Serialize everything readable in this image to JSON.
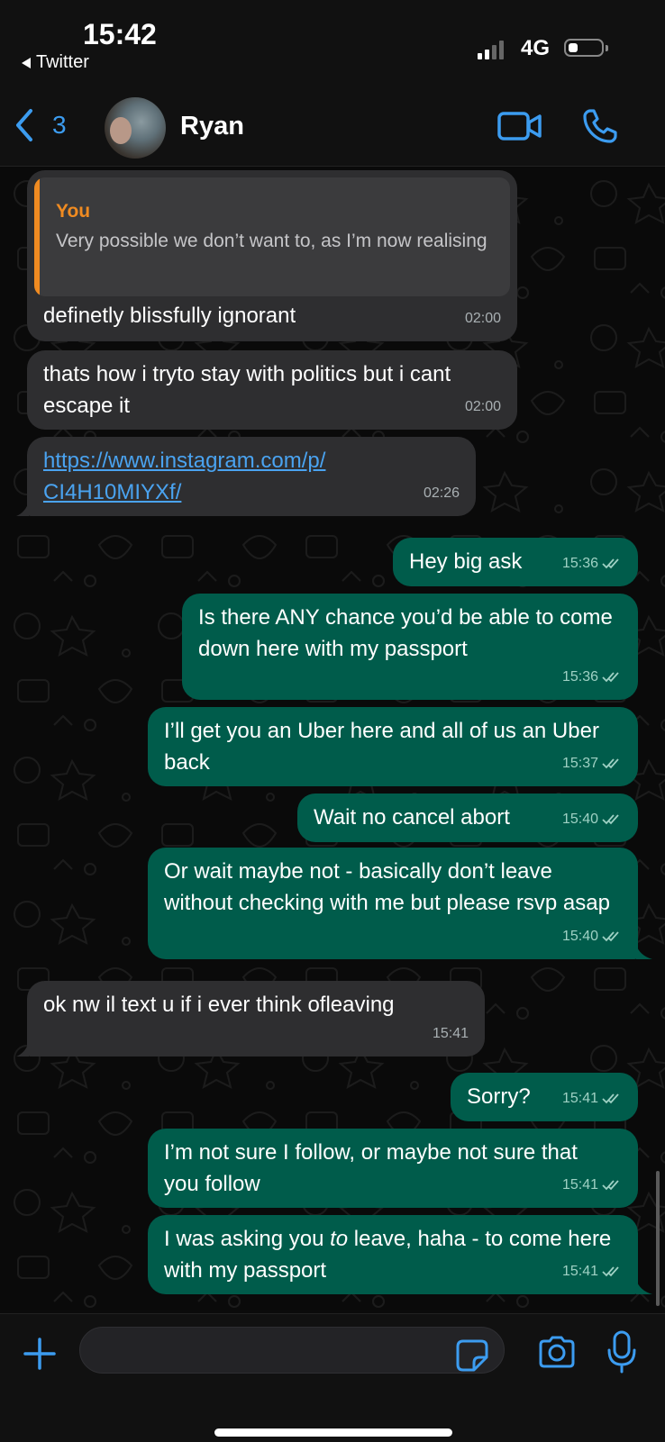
{
  "status_bar": {
    "time": "15:42",
    "back_app": "Twitter",
    "network": "4G"
  },
  "header": {
    "back_count": "3",
    "contact_name": "Ryan"
  },
  "messages": [
    {
      "dir": "in",
      "quoted_author": "You",
      "quoted_text": "Very possible we don’t want to, as I’m now realising",
      "text": "definetly blissfully ignorant",
      "time": "02:00"
    },
    {
      "dir": "in",
      "text": "thats how i tryto stay with politics but i cant escape it",
      "time": "02:00"
    },
    {
      "dir": "in",
      "text": "https://www.instagram.com/p/CI4H10MIYXf/",
      "text_line1": "https://www.instagram.com/p/",
      "text_line2": "CI4H10MIYXf/",
      "time": "02:26"
    },
    {
      "dir": "out",
      "text": "Hey big ask",
      "time": "15:36"
    },
    {
      "dir": "out",
      "text": "Is there ANY chance you’d be able to come down here with my passport",
      "time": "15:36"
    },
    {
      "dir": "out",
      "text": "I’ll get you an Uber here and all of us an Uber back",
      "time": "15:37"
    },
    {
      "dir": "out",
      "text": "Wait no cancel abort",
      "time": "15:40"
    },
    {
      "dir": "out",
      "text": "Or wait maybe not - basically don’t leave without checking with me but please rsvp asap",
      "time": "15:40"
    },
    {
      "dir": "in",
      "text": "ok nw il text u if i ever think ofleaving",
      "time": "15:41"
    },
    {
      "dir": "out",
      "text": "Sorry?",
      "time": "15:41"
    },
    {
      "dir": "out",
      "text": "I’m not sure I follow, or maybe not sure that you follow",
      "time": "15:41"
    },
    {
      "dir": "out",
      "text_before": "I was asking you ",
      "text_em": "to",
      "text_after": " leave, haha - to come here with my passport",
      "time": "15:41"
    }
  ],
  "icons": [
    "chevron-left-icon",
    "video-call-icon",
    "phone-icon",
    "plus-icon",
    "sticker-icon",
    "camera-icon",
    "microphone-icon",
    "double-check-icon"
  ],
  "colors": {
    "accent": "#3c9cf0",
    "outgoing_bubble": "#005c4b",
    "incoming_bubble": "#2e2e30",
    "quote_bar": "#f08b21"
  }
}
